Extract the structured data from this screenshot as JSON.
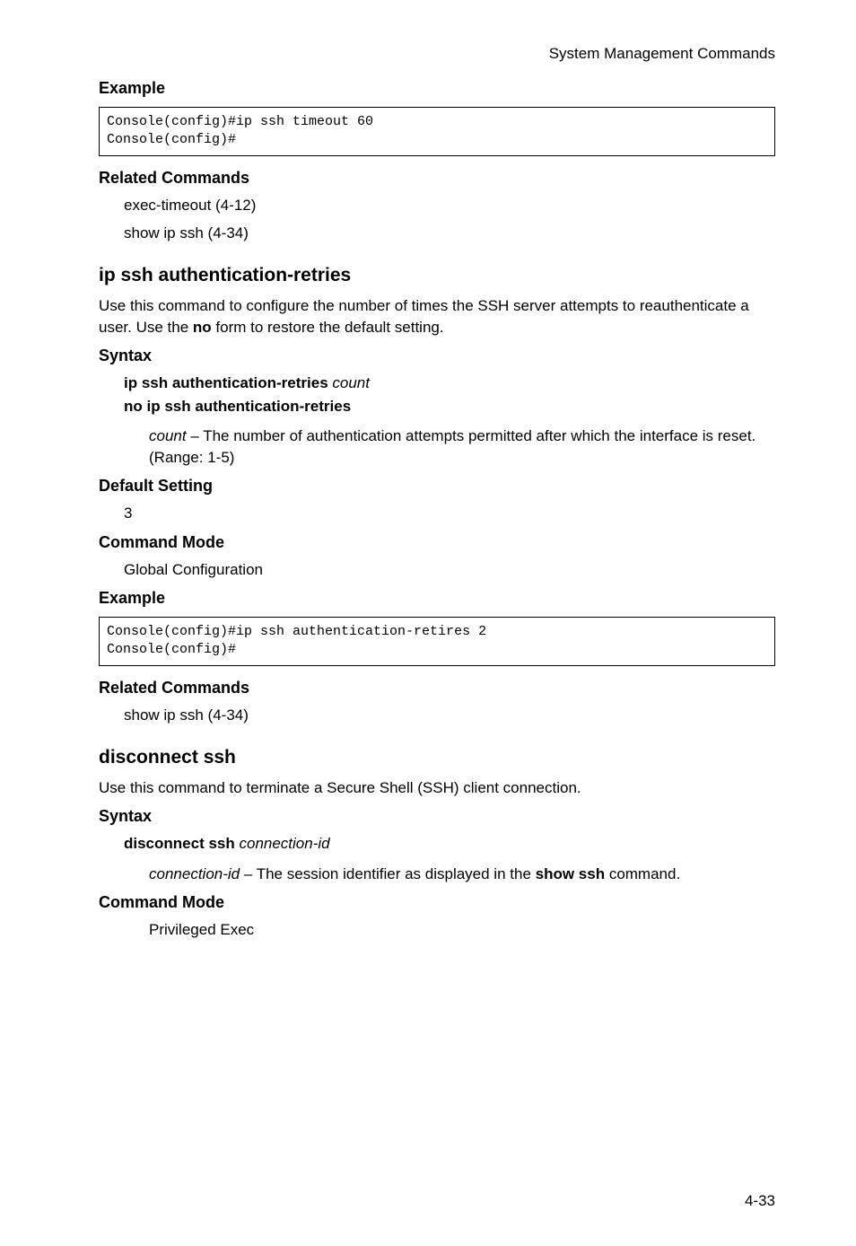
{
  "header": {
    "right": "System Management Commands"
  },
  "sec1": {
    "example_h": "Example",
    "code1": "Console(config)#ip ssh timeout 60\nConsole(config)#",
    "related_h": "Related Commands",
    "related_1": "exec-timeout (4-12)",
    "related_2": "show ip ssh (4-34)"
  },
  "sec2": {
    "title": "ip ssh authentication-retries",
    "desc_a": "Use this command to configure the number of times the SSH server attempts to reauthenticate a user. Use the ",
    "desc_bold": "no",
    "desc_b": " form to restore the default setting.",
    "syntax_h": "Syntax",
    "syntax_line1_bold": "ip ssh authentication-retries ",
    "syntax_line1_italic": "count",
    "syntax_line2": "no ip ssh authentication-retries",
    "param_italic": "count",
    "param_rest": " – The number of authentication attempts permitted after which the interface is reset. (Range: 1-5)",
    "default_h": "Default Setting",
    "default_v": "3",
    "mode_h": "Command Mode",
    "mode_v": "Global Configuration",
    "example_h": "Example",
    "code2": "Console(config)#ip ssh authentication-retires 2\nConsole(config)#",
    "related_h": "Related Commands",
    "related_1": "show ip ssh (4-34)"
  },
  "sec3": {
    "title": "disconnect ssh",
    "desc": "Use this command to terminate a Secure Shell (SSH) client connection.",
    "syntax_h": "Syntax",
    "syntax_line_bold": "disconnect ssh ",
    "syntax_line_italic": "connection-id",
    "param_italic": "connection-id",
    "param_mid": " – The session identifier as displayed in the ",
    "param_bold": "show ssh",
    "param_end": " command.",
    "mode_h": "Command Mode",
    "mode_v": "Privileged Exec"
  },
  "footer": {
    "page": "4-33"
  }
}
